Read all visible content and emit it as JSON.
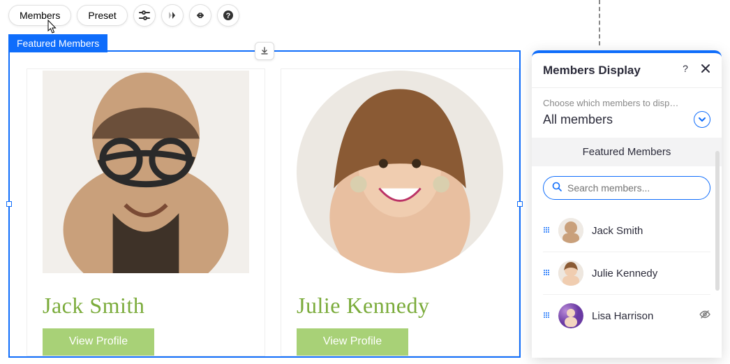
{
  "toolbar": {
    "members_label": "Members",
    "preset_label": "Preset"
  },
  "selection_tag": "Featured Members",
  "cards": [
    {
      "name": "Jack Smith",
      "view_label": "View Profile"
    },
    {
      "name": "Julie Kennedy",
      "view_label": "View Profile"
    }
  ],
  "panel": {
    "title": "Members Display",
    "section_label": "Choose which members to disp…",
    "dropdown_value": "All members",
    "subheader": "Featured Members",
    "search_placeholder": "Search members...",
    "list": [
      {
        "name": "Jack Smith"
      },
      {
        "name": "Julie Kennedy"
      },
      {
        "name": "Lisa Harrison"
      }
    ]
  }
}
